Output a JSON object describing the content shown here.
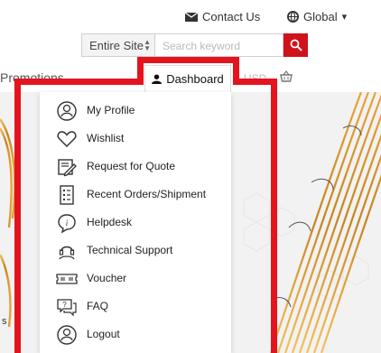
{
  "header": {
    "contact_label": "Contact Us",
    "global_label": "Global",
    "global_caret": "▾"
  },
  "search": {
    "scope_value": "Entire Site",
    "placeholder": "Search keyword"
  },
  "nav": {
    "promotions_label": "Promotions",
    "dashboard_label": "Dashboard",
    "currency_label": "USD"
  },
  "menu": {
    "items": [
      {
        "label": "My Profile",
        "icon": "profile-icon"
      },
      {
        "label": "Wishlist",
        "icon": "heart-icon"
      },
      {
        "label": "Request for Quote",
        "icon": "quote-icon"
      },
      {
        "label": "Recent Orders/Shipment",
        "icon": "orders-icon"
      },
      {
        "label": "Helpdesk",
        "icon": "helpdesk-icon"
      },
      {
        "label": "Technical Support",
        "icon": "support-icon"
      },
      {
        "label": "Voucher",
        "icon": "voucher-icon"
      },
      {
        "label": "FAQ",
        "icon": "faq-icon"
      },
      {
        "label": "Logout",
        "icon": "logout-icon"
      }
    ]
  },
  "edge_text": "s",
  "colors": {
    "brand_red": "#d0121b",
    "highlight_red": "#e4141f",
    "column_gold": "#c8841e"
  }
}
